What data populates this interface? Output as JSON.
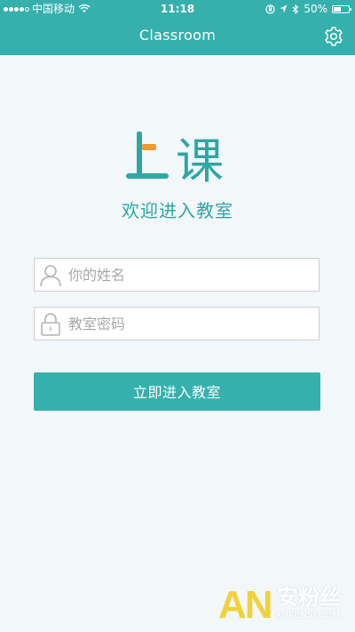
{
  "status_bar": {
    "carrier": "中国移动",
    "time": "11:18",
    "battery": "50%",
    "battery_level": 0.5
  },
  "nav": {
    "title": "Classroom",
    "settings_icon": "gear-icon"
  },
  "logo": {
    "text": "上课",
    "color": "#2ea7a4",
    "accent_color": "#f29a2e"
  },
  "welcome_text": "欢迎进入教室",
  "form": {
    "name": {
      "placeholder": "你的姓名",
      "value": "",
      "icon": "user-icon"
    },
    "password": {
      "placeholder": "教室密码",
      "value": "",
      "icon": "lock-icon"
    },
    "submit_label": "立即进入教室"
  },
  "watermark": {
    "logo": "AN",
    "text": "安粉丝",
    "url": "ANFENSI.COM"
  },
  "colors": {
    "primary": "#36b0ad",
    "background": "#f2f7fa",
    "border": "#c9cdd0",
    "placeholder": "#a9a9a9"
  }
}
